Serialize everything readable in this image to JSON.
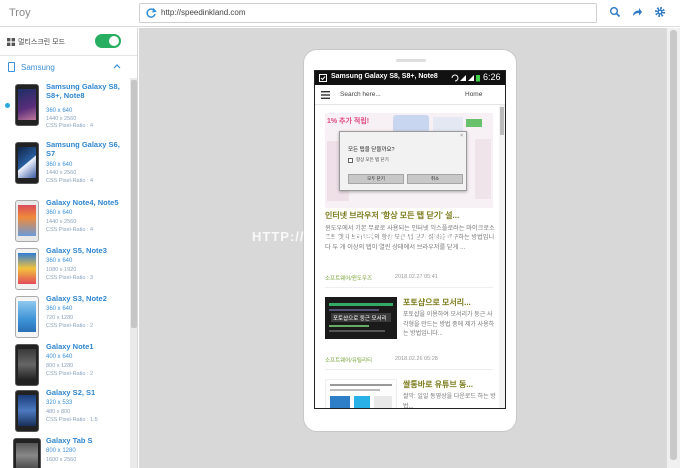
{
  "app": {
    "title": "Troy"
  },
  "address_bar": {
    "url": "http://speedinkland.com"
  },
  "toolbar": {
    "icons": [
      "search-icon",
      "share-icon",
      "gear-icon"
    ]
  },
  "sidebar": {
    "mode_label": "멀티스크린 모드",
    "mode_on": true,
    "group_label": "Samsung",
    "devices": [
      {
        "name": "Samsung Galaxy S8, S8+, Note8",
        "size": "360 x 640",
        "res": "1440 x 2560",
        "ratio": "CSS Pixel-Ratio : 4",
        "selected": true
      },
      {
        "name": "Samsung Galaxy S6, S7",
        "size": "360 x 640",
        "res": "1440 x 2560",
        "ratio": "CSS Pixel-Ratio : 4"
      },
      {
        "name": "Galaxy Note4, Note5",
        "size": "360 x 640",
        "res": "1440 x 2560",
        "ratio": "CSS Pixel-Ratio : 4"
      },
      {
        "name": "Galaxy S5, Note3",
        "size": "360 x 640",
        "res": "1080 x 1920",
        "ratio": "CSS Pixel-Ratio : 3"
      },
      {
        "name": "Galaxy S3, Note2",
        "size": "360 x 640",
        "res": "720 x 1280",
        "ratio": "CSS Pixel-Ratio : 2"
      },
      {
        "name": "Galaxy Note1",
        "size": "400 x 640",
        "res": "800 x 1280",
        "ratio": "CSS Pixel-Ratio : 2"
      },
      {
        "name": "Galaxy S2, S1",
        "size": "320 x 533",
        "res": "480 x 800",
        "ratio": "CSS Pixel-Ratio : 1.5"
      },
      {
        "name": "Galaxy Tab S",
        "size": "800 x 1280",
        "res": "1600 x 2560",
        "ratio": ""
      }
    ]
  },
  "emulator": {
    "status_title": "Samsung Galaxy S8, S8+, Note8",
    "time": "6:26",
    "search_placeholder": "Search here...",
    "home_label": "Home",
    "ad_text": "1% 추가 적립!",
    "dialog": {
      "question": "모든 탭을 닫을까요?",
      "checkbox_label": "항상 모든 탭 닫기",
      "ok": "모두 닫기",
      "cancel": "취소",
      "close": "×"
    },
    "articles": [
      {
        "title": "인터넷 브라우저 '항상 모든 탭 닫기' 설...",
        "body": "윈도우에서 기본 무료로 사용되는 인터넷 익스플로러는 마이크로소프트 엣지 브라우저의 항상 모든 탭 닫기 설정을 복구하는 방법입니다 두 개 이상의 탭이 열린 상태에서 브라우저를 닫게 ...",
        "category": "소프트웨어/윈도우즈",
        "date": "2018.02.27 05:41"
      },
      {
        "title": "포토샵으로 모서리...",
        "body": "포토샵을 이용하여 모서리가 둥근 사각형을 만드는 방법 중에 제가 사용하는 방법입니다...",
        "thumb_text": "포토샵으로 둥근 모서리",
        "category": "소프트웨어/유틸리티",
        "date": "2018.02.26 05:28"
      },
      {
        "title": "쌀통바로 유튜브 동...",
        "body": "쌀악: 일일 동영상을 다운로드 하는 방법..."
      }
    ]
  },
  "watermark": "HTTP://SPEEDINKLAND.COM"
}
